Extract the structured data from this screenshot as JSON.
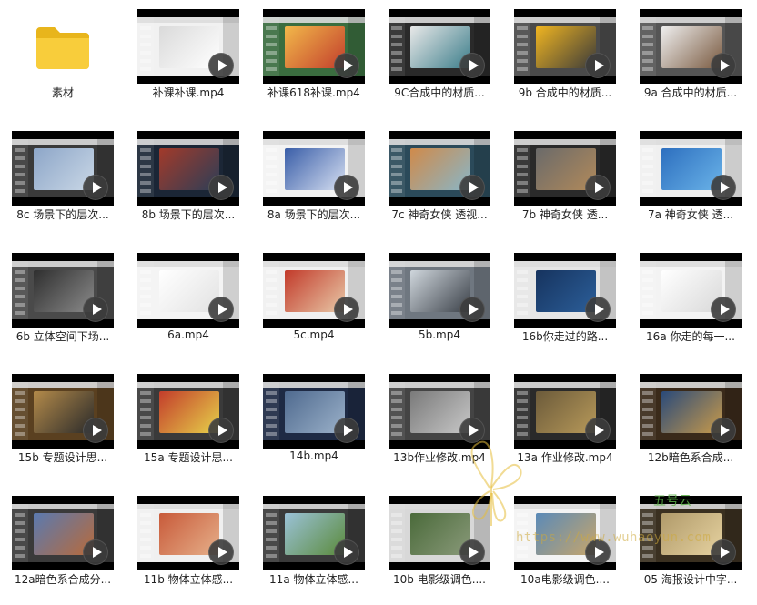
{
  "files": [
    {
      "name": "素材",
      "type": "folder",
      "row": 0,
      "col": 0
    },
    {
      "name": "补课补课.mp4",
      "type": "video",
      "row": 0,
      "col": 1,
      "colors": [
        "#f1f1f1",
        "#dadada",
        "#ffffff"
      ]
    },
    {
      "name": "补课618补课.mp4",
      "type": "video",
      "row": 0,
      "col": 2,
      "colors": [
        "#3a6d3f",
        "#f2b84a",
        "#c23e2c"
      ]
    },
    {
      "name": "9C合成中的材质...",
      "type": "video",
      "row": 0,
      "col": 3,
      "colors": [
        "#2a2a2a",
        "#e8e8e8",
        "#3b7d8a"
      ]
    },
    {
      "name": "9b 合成中的材质...",
      "type": "video",
      "row": 0,
      "col": 4,
      "colors": [
        "#4a4a4a",
        "#f0b521",
        "#3a3a3a"
      ]
    },
    {
      "name": "9a 合成中的材质...",
      "type": "video",
      "row": 0,
      "col": 5,
      "colors": [
        "#555",
        "#eeeeee",
        "#7a5a40"
      ]
    },
    {
      "name": "8c 场景下的层次...",
      "type": "video",
      "row": 1,
      "col": 0,
      "colors": [
        "#3a3a3a",
        "#8da6c8",
        "#c9d7e6"
      ]
    },
    {
      "name": "8b 场景下的层次...",
      "type": "video",
      "row": 1,
      "col": 1,
      "colors": [
        "#1b2636",
        "#a23a2a",
        "#2c3e57"
      ]
    },
    {
      "name": "8a 场景下的层次...",
      "type": "video",
      "row": 1,
      "col": 2,
      "colors": [
        "#f3f3f3",
        "#3a5ea8",
        "#d6dff1"
      ]
    },
    {
      "name": "7c 神奇女侠 透视...",
      "type": "video",
      "row": 1,
      "col": 3,
      "colors": [
        "#2b4a5a",
        "#d08a4a",
        "#88b6c8"
      ]
    },
    {
      "name": "7b 神奇女侠 透...",
      "type": "video",
      "row": 1,
      "col": 4,
      "colors": [
        "#2a2a2a",
        "#6a6a6a",
        "#b28a5a"
      ]
    },
    {
      "name": "7a 神奇女侠 透...",
      "type": "video",
      "row": 1,
      "col": 5,
      "colors": [
        "#f0f0f0",
        "#2d6fbf",
        "#6ab3e8"
      ]
    },
    {
      "name": "6b 立体空间下场...",
      "type": "video",
      "row": 2,
      "col": 0,
      "colors": [
        "#4a4a4a",
        "#2f2f2f",
        "#8a8a8a"
      ]
    },
    {
      "name": "6a.mp4",
      "type": "video",
      "row": 2,
      "col": 1,
      "colors": [
        "#f4f4f4",
        "#ffffff",
        "#e2e2e2"
      ]
    },
    {
      "name": "5c.mp4",
      "type": "video",
      "row": 2,
      "col": 2,
      "colors": [
        "#f0f0f0",
        "#c23a2a",
        "#e8c9a8"
      ]
    },
    {
      "name": "5b.mp4",
      "type": "video",
      "row": 2,
      "col": 3,
      "colors": [
        "#6f7780",
        "#cfd6dc",
        "#3a4048"
      ]
    },
    {
      "name": "16b你走过的路...",
      "type": "video",
      "row": 2,
      "col": 4,
      "colors": [
        "#e6e6e6",
        "#16335e",
        "#2c5f9a"
      ]
    },
    {
      "name": "16a 你走的每一...",
      "type": "video",
      "row": 2,
      "col": 5,
      "colors": [
        "#f3f3f3",
        "#ffffff",
        "#d9d9d9"
      ]
    },
    {
      "name": "15b 专题设计思...",
      "type": "video",
      "row": 3,
      "col": 0,
      "colors": [
        "#5a4020",
        "#b38a4a",
        "#2a2a2a"
      ]
    },
    {
      "name": "15a 专题设计思...",
      "type": "video",
      "row": 3,
      "col": 1,
      "colors": [
        "#3a3a3a",
        "#c33d2b",
        "#e6d24a"
      ]
    },
    {
      "name": "14b.mp4",
      "type": "video",
      "row": 3,
      "col": 2,
      "colors": [
        "#1e2a44",
        "#4f6a8f",
        "#9bb1c9"
      ]
    },
    {
      "name": "13b作业修改.mp4",
      "type": "video",
      "row": 3,
      "col": 3,
      "colors": [
        "#444",
        "#7a7a7a",
        "#c8c8c8"
      ]
    },
    {
      "name": "13a 作业修改.mp4",
      "type": "video",
      "row": 3,
      "col": 4,
      "colors": [
        "#2a2a2a",
        "#6b5a3a",
        "#b89a5a"
      ]
    },
    {
      "name": "12b暗色系合成...",
      "type": "video",
      "row": 3,
      "col": 5,
      "colors": [
        "#3a2a1a",
        "#2a4a7a",
        "#c89a4a"
      ]
    },
    {
      "name": "12a暗色系合成分...",
      "type": "video",
      "row": 4,
      "col": 0,
      "colors": [
        "#3a3a3a",
        "#5a7ab0",
        "#b86a3a"
      ]
    },
    {
      "name": "11b 物体立体感...",
      "type": "video",
      "row": 4,
      "col": 1,
      "colors": [
        "#f0f0f0",
        "#c85a3a",
        "#e6b08a"
      ]
    },
    {
      "name": "11a 物体立体感...",
      "type": "video",
      "row": 4,
      "col": 2,
      "colors": [
        "#3a3a3a",
        "#9bc2d8",
        "#5a8a3a"
      ]
    },
    {
      "name": "10b 电影级调色....",
      "type": "video",
      "row": 4,
      "col": 3,
      "colors": [
        "#d8d8d8",
        "#4a6a3a",
        "#8a9a7a"
      ]
    },
    {
      "name": "10a电影级调色....",
      "type": "video",
      "row": 4,
      "col": 4,
      "colors": [
        "#f3f3f3",
        "#5a8ab8",
        "#c8a66a"
      ]
    },
    {
      "name": "05 海报设计中字...",
      "type": "video",
      "row": 4,
      "col": 5,
      "colors": [
        "#3a3020",
        "#b09a6a",
        "#e6d2a0"
      ]
    }
  ],
  "watermark": {
    "brand": "五号云",
    "url": "https://www.wuhaoyun.com"
  }
}
